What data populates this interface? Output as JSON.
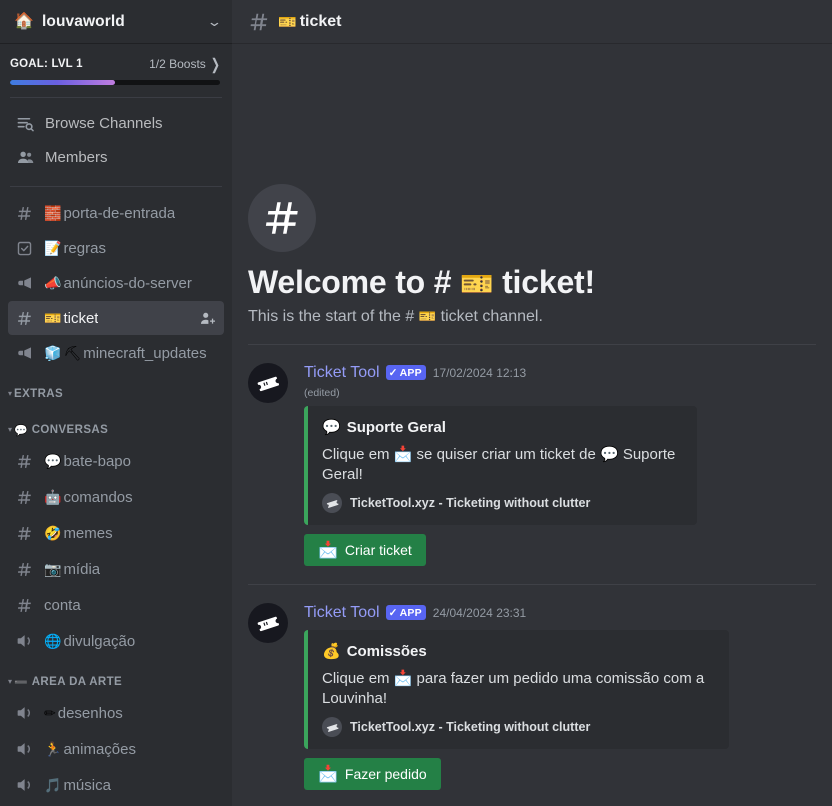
{
  "sidebar": {
    "server": {
      "name": "louvaworld",
      "emoji": "🏠",
      "chevron_icon": "chevron-down-icon"
    },
    "boost": {
      "goal_label": "GOAL: LVL 1",
      "count_label": "1/2 Boosts",
      "progress_percent": 50,
      "fill_start_color": "#3f7de0",
      "fill_end_color": "#c07de0"
    },
    "nav": [
      {
        "label": "Browse Channels",
        "icon": "browse-channels-icon"
      },
      {
        "label": "Members",
        "icon": "members-icon"
      }
    ],
    "channels_top": [
      {
        "name": "porta-de-entrada",
        "emoji": "🧱",
        "type": "text",
        "icon": "hash-icon",
        "active": false
      },
      {
        "name": "regras",
        "emoji": "📝",
        "type": "rules",
        "icon": "rules-icon",
        "active": false
      },
      {
        "name": "anúncios-do-server",
        "emoji": "📣",
        "type": "announcement",
        "icon": "megaphone-icon",
        "active": false
      },
      {
        "name": "ticket",
        "emoji": "🎫",
        "type": "text",
        "icon": "hash-icon",
        "active": true,
        "action_icon": "add-member-icon"
      },
      {
        "name": "minecraft_updates",
        "emoji": "🧊",
        "emoji2": "⛏",
        "type": "announcement",
        "icon": "megaphone-icon",
        "active": false
      }
    ],
    "categories": [
      {
        "name": "EXTRAS",
        "emoji": "",
        "channels": []
      },
      {
        "name": "CONVERSAS",
        "emoji": "💬",
        "channels": [
          {
            "name": "bate-bapo",
            "emoji": "💬",
            "type": "text",
            "icon": "hash-icon"
          },
          {
            "name": "comandos",
            "emoji": "🤖",
            "type": "text",
            "icon": "hash-icon"
          },
          {
            "name": "memes",
            "emoji": "🤣",
            "type": "text",
            "icon": "hash-icon"
          },
          {
            "name": "mídia",
            "emoji": "📷",
            "type": "text",
            "icon": "hash-icon"
          },
          {
            "name": "conta",
            "emoji": "",
            "type": "text",
            "icon": "hash-icon"
          },
          {
            "name": "divulgação",
            "emoji": "🌐",
            "type": "voice",
            "icon": "voice-icon"
          }
        ]
      },
      {
        "name": "AREA DA ARTE",
        "emoji": "➖",
        "channels": [
          {
            "name": "desenhos",
            "emoji": "✏",
            "type": "voice",
            "icon": "voice-icon"
          },
          {
            "name": "animações",
            "emoji": "🏃",
            "type": "voice",
            "icon": "voice-icon"
          },
          {
            "name": "música",
            "emoji": "🎵",
            "type": "voice",
            "icon": "voice-icon"
          }
        ]
      }
    ]
  },
  "header": {
    "hash_icon": "hash-icon",
    "emoji": "🎫",
    "title": "ticket"
  },
  "welcome": {
    "icon_glyph": "#",
    "title_prefix": "Welcome to # ",
    "title_emoji": "🎫",
    "title_suffix": " ticket!",
    "sub_prefix": "This is the start of the # ",
    "sub_emoji": "🎫",
    "sub_suffix": " ticket channel."
  },
  "messages": [
    {
      "author": "Ticket Tool",
      "badge": "APP",
      "badge_check_icon": "verified-check-icon",
      "timestamp": "17/02/2024 12:13",
      "edited": "(edited)",
      "avatar_icon": "ticket-avatar-icon",
      "embed": {
        "accent_color": "#3ba55c",
        "title_emoji": "💬",
        "title": "Suporte Geral",
        "desc_prefix": "Clique em ",
        "desc_emoji1": "📩",
        "desc_middle": " se quiser criar um ticket de ",
        "desc_emoji2": "💬",
        "desc_suffix": " Suporte Geral!",
        "footer_icon": "tickettool-icon",
        "footer_text": "TicketTool.xyz - Ticketing without clutter"
      },
      "button": {
        "emoji": "📩",
        "label": "Criar ticket",
        "color": "#248046"
      }
    },
    {
      "author": "Ticket Tool",
      "badge": "APP",
      "badge_check_icon": "verified-check-icon",
      "timestamp": "24/04/2024 23:31",
      "edited": "",
      "avatar_icon": "ticket-avatar-icon",
      "embed": {
        "accent_color": "#3ba55c",
        "title_emoji": "💰",
        "title": "Comissões",
        "desc_prefix": "Clique em ",
        "desc_emoji1": "📩",
        "desc_middle": " para fazer um pedido uma comissão com a Louvinha!",
        "desc_emoji2": "",
        "desc_suffix": "",
        "footer_icon": "tickettool-icon",
        "footer_text": "TicketTool.xyz - Ticketing without clutter"
      },
      "button": {
        "emoji": "📩",
        "label": "Fazer pedido",
        "color": "#248046"
      }
    }
  ]
}
